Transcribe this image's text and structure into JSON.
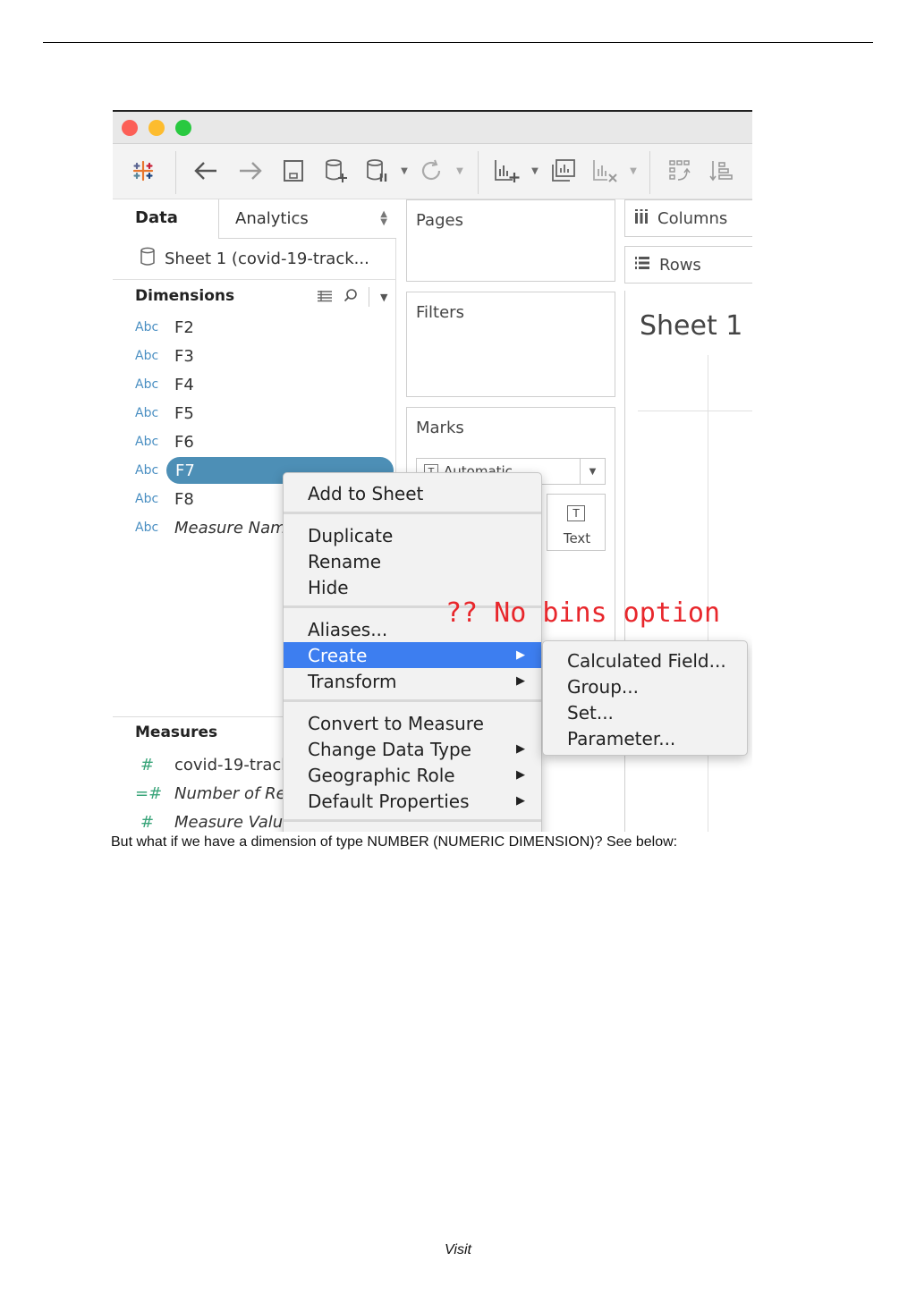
{
  "tableau": {
    "tabs": {
      "data": "Data",
      "analytics": "Analytics"
    },
    "data_source": "Sheet 1 (covid-19-track...",
    "dimensions": {
      "header": "Dimensions",
      "fields": [
        {
          "type": "Abc",
          "name": "F2"
        },
        {
          "type": "Abc",
          "name": "F3"
        },
        {
          "type": "Abc",
          "name": "F4"
        },
        {
          "type": "Abc",
          "name": "F5"
        },
        {
          "type": "Abc",
          "name": "F6"
        },
        {
          "type": "Abc",
          "name": "F7"
        },
        {
          "type": "Abc",
          "name": "F8"
        },
        {
          "type": "Abc",
          "name": "Measure Nam"
        }
      ]
    },
    "measures": {
      "header": "Measures",
      "fields": [
        {
          "type": "#",
          "name": "covid-19-track"
        },
        {
          "type": "=#",
          "name": "Number of Rec"
        },
        {
          "type": "#",
          "name": "Measure Value"
        }
      ]
    },
    "cards": {
      "pages": "Pages",
      "filters": "Filters",
      "marks": "Marks"
    },
    "marks_type": "Automatic",
    "marks_text_button": "Text",
    "shelves": {
      "columns": "Columns",
      "rows": "Rows"
    },
    "sheet_title": "Sheet 1",
    "context_menu": {
      "add_to_sheet": "Add to Sheet",
      "duplicate": "Duplicate",
      "rename": "Rename",
      "hide": "Hide",
      "aliases": "Aliases...",
      "create": "Create",
      "transform": "Transform",
      "convert_to_measure": "Convert to Measure",
      "change_data_type": "Change Data Type",
      "geographic_role": "Geographic Role",
      "default_properties": "Default Properties",
      "arrow": "▶"
    },
    "create_submenu": {
      "calculated_field": "Calculated Field...",
      "group": "Group...",
      "set": "Set...",
      "parameter": "Parameter..."
    },
    "annotation": "?? No bins option",
    "annotation_color": "#e8272c",
    "highlight_color": "#3d7ef0",
    "selected_pill_color": "#4d8fb6"
  },
  "caption": "But what if we have a dimension of type NUMBER (NUMERIC DIMENSION)? See below:",
  "footer": "Visit"
}
